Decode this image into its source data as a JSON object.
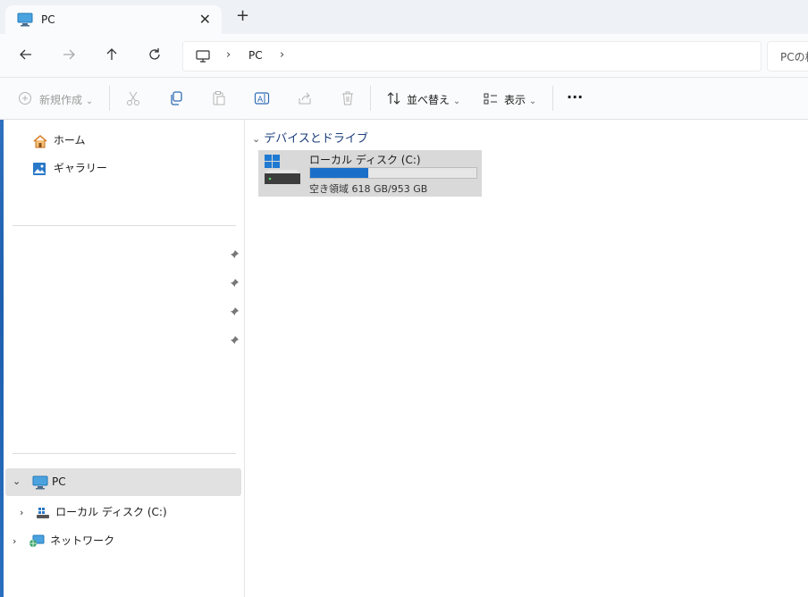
{
  "window": {
    "tab_title": "PC",
    "close_glyph": "✕",
    "new_tab_glyph": "+"
  },
  "address": {
    "breadcrumb": "PC",
    "separator": "›",
    "search_placeholder": "PCの検索"
  },
  "toolbar": {
    "new_label": "新規作成",
    "sort_label": "並べ替え",
    "view_label": "表示",
    "more_label": "···",
    "dropdown_glyph": "⌄"
  },
  "sidebar": {
    "home": "ホーム",
    "gallery": "ギャラリー",
    "pc": "PC",
    "local_disk": "ローカル ディスク (C:)",
    "network": "ネットワーク",
    "expand_glyph": "›",
    "collapse_glyph": "⌄"
  },
  "content": {
    "group_header": "デバイスとドライブ",
    "group_chevron": "⌄",
    "drive": {
      "name": "ローカル ディスク (C:)",
      "free_text": "空き領域 618 GB/953 GB",
      "used_fraction": 0.352
    }
  },
  "colors": {
    "accent": "#1a6fc9",
    "selection": "#e1e1e1",
    "group_header": "#1a3d7a"
  },
  "icons": [
    "monitor-icon",
    "back-arrow-icon",
    "forward-arrow-icon",
    "up-arrow-icon",
    "refresh-icon",
    "cut-icon",
    "copy-icon",
    "paste-icon",
    "rename-icon",
    "share-icon",
    "delete-icon",
    "sort-icon",
    "view-icon",
    "home-icon",
    "gallery-icon",
    "pin-icon",
    "drive-icon",
    "network-icon"
  ]
}
